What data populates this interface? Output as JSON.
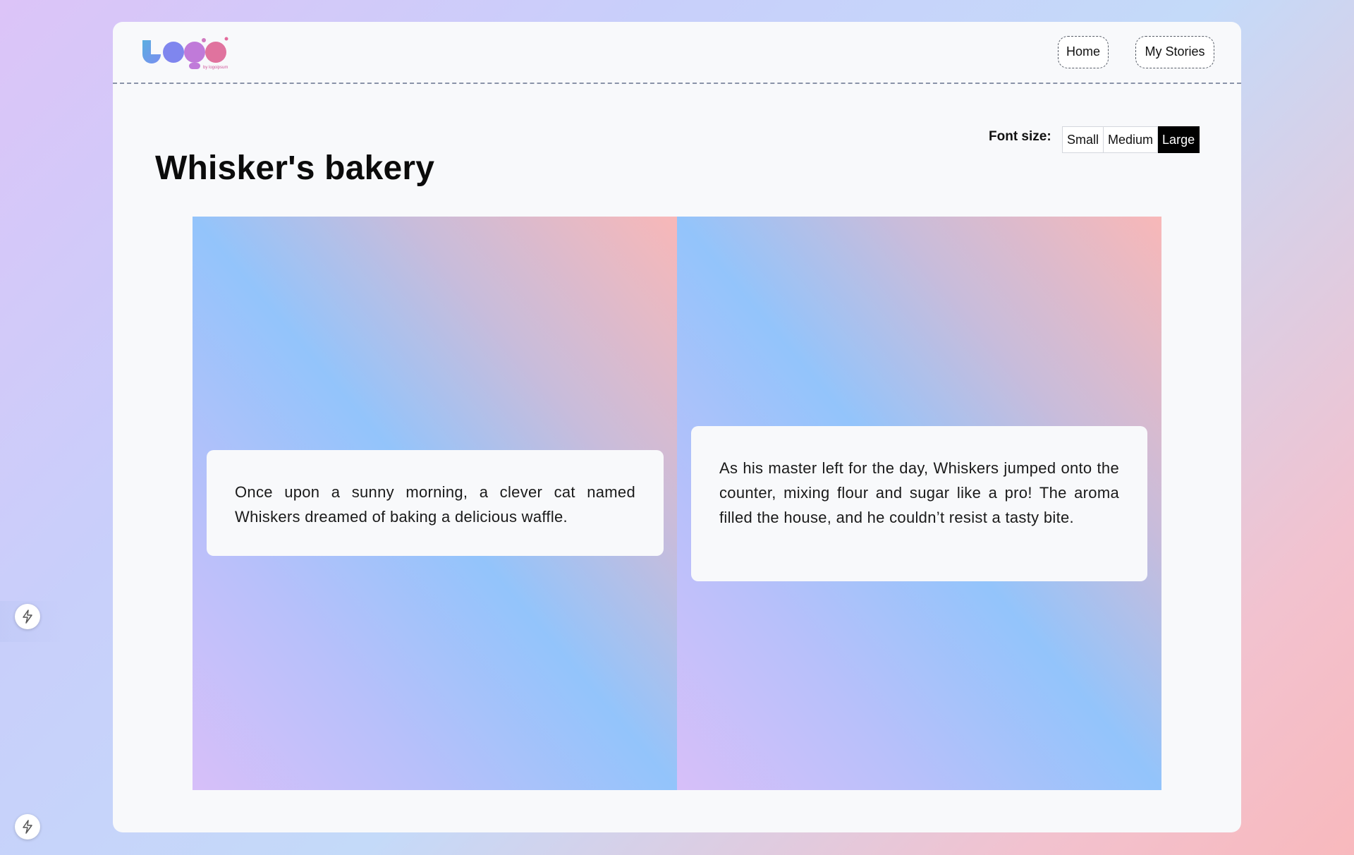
{
  "header": {
    "logo_text": "by logoipsum",
    "nav": [
      {
        "label": "Home"
      },
      {
        "label": "My Stories"
      }
    ]
  },
  "story": {
    "title": "Whisker's bakery",
    "pages": [
      {
        "text": "Once upon a sunny morning, a clever cat named Whiskers dreamed of baking a delicious waffle."
      },
      {
        "text": "As his master left for the day, Whiskers jumped onto the counter, mixing flour and sugar like a pro! The aroma filled the house, and he couldn’t resist a tasty bite."
      }
    ]
  },
  "font_size": {
    "label": "Font size:",
    "options": [
      "Small",
      "Medium",
      "Large"
    ],
    "selected": "Large"
  },
  "side_icons": [
    "lightning-icon",
    "lightning-icon"
  ],
  "colors": {
    "accent_pink": "#e46a9c",
    "accent_blue": "#5fa6e6",
    "selected_bg": "#000000"
  }
}
